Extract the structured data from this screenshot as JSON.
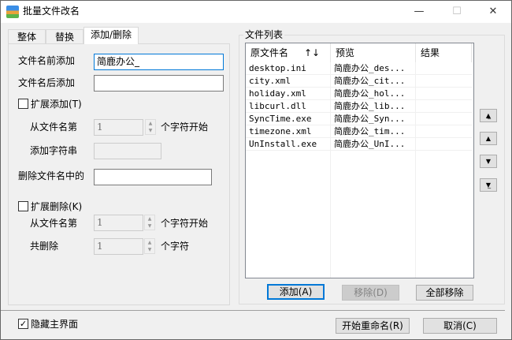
{
  "window": {
    "title": "批量文件改名",
    "minimize": "—",
    "maximize": "☐",
    "close": "✕"
  },
  "tabs": [
    "整体",
    "替换",
    "添加/删除"
  ],
  "form": {
    "prefix_label": "文件名前添加",
    "prefix_value": "简鹿办公_",
    "suffix_label": "文件名后添加",
    "suffix_value": "",
    "ext_add_label": "扩展添加(T)",
    "ext_add_checked": false,
    "from_pos_label": "从文件名第",
    "from_pos_value": "1",
    "from_pos_unit": "个字符开始",
    "add_str_label": "添加字符串",
    "add_str_value": "",
    "delete_label": "删除文件名中的",
    "delete_value": "",
    "ext_del_label": "扩展删除(K)",
    "ext_del_checked": false,
    "del_from_label": "从文件名第",
    "del_from_value": "1",
    "del_from_unit": "个字符开始",
    "del_count_label": "共删除",
    "del_count_value": "1",
    "del_count_unit": "个字符"
  },
  "filelist": {
    "title": "文件列表",
    "columns": [
      "原文件名",
      "预览",
      "结果"
    ],
    "sort_icon": "↑↓",
    "rows": [
      {
        "name": "desktop.ini",
        "preview": "简鹿办公_des...",
        "result": ""
      },
      {
        "name": "city.xml",
        "preview": "简鹿办公_cit...",
        "result": ""
      },
      {
        "name": "holiday.xml",
        "preview": "简鹿办公_hol...",
        "result": ""
      },
      {
        "name": "libcurl.dll",
        "preview": "简鹿办公_lib...",
        "result": ""
      },
      {
        "name": "SyncTime.exe",
        "preview": "简鹿办公_Syn...",
        "result": ""
      },
      {
        "name": "timezone.xml",
        "preview": "简鹿办公_tim...",
        "result": ""
      },
      {
        "name": "UnInstall.exe",
        "preview": "简鹿办公_UnI...",
        "result": ""
      }
    ],
    "add": "添加(A)",
    "remove": "移除(D)",
    "remove_all": "全部移除"
  },
  "footer": {
    "hide_main_label": "隐藏主界面",
    "hide_main_checked": true,
    "start": "开始重命名(R)",
    "cancel": "取消(C)"
  }
}
